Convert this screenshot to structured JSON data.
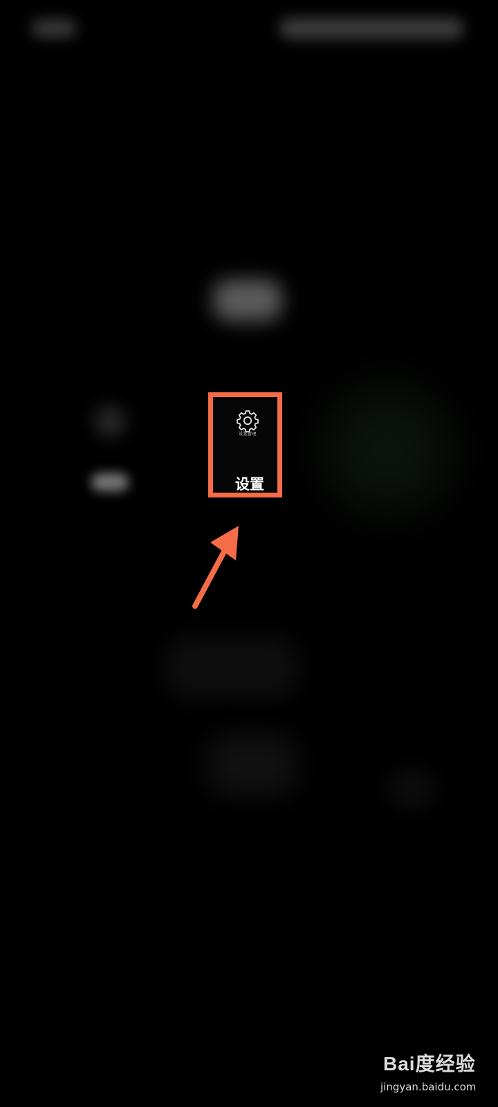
{
  "settings_app": {
    "label": "设置",
    "icon": "gear-icon",
    "icon_caption": "设置管理"
  },
  "highlight": {
    "color": "#f56c48"
  },
  "watermark": {
    "logo_text": "Bai度经验",
    "url": "jingyan.baidu.com"
  }
}
